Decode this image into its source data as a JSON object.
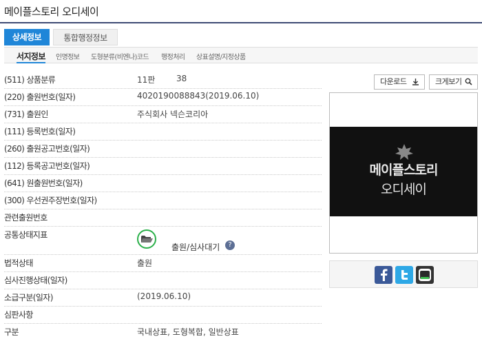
{
  "header": {
    "title": "메이플스토리 오디세이"
  },
  "tabs": [
    {
      "label": "상세정보",
      "active": true
    },
    {
      "label": "통합행정정보",
      "active": false
    }
  ],
  "subnav": [
    "서지정보",
    "인명정보",
    "도형분류(비엔나)코드",
    "행정처리",
    "상표설명/지정상품"
  ],
  "rows": [
    {
      "label": "(511) 상품분류",
      "value": "11판",
      "value2": "38"
    },
    {
      "label": "(220) 출원번호(일자)",
      "value": "4020190088843(2019.06.10)"
    },
    {
      "label": "(731) 출원인",
      "value": "주식회사 넥슨코리아"
    },
    {
      "label": "(111) 등록번호(일자)",
      "value": ""
    },
    {
      "label": "(260) 출원공고번호(일자)",
      "value": ""
    },
    {
      "label": "(112) 등록공고번호(일자)",
      "value": ""
    },
    {
      "label": "(641) 원출원번호(일자)",
      "value": ""
    },
    {
      "label": "(300) 우선권주장번호(일자)",
      "value": ""
    },
    {
      "label": "관련출원번호",
      "value": ""
    },
    {
      "label": "공통상태지표",
      "value": "출원/심사대기"
    },
    {
      "label": "법적상태",
      "value": "출원"
    },
    {
      "label": "심사진행상태(일자)",
      "value": ""
    },
    {
      "label": "소급구분(일자)",
      "value": "(2019.06.10)"
    },
    {
      "label": "심판사항",
      "value": ""
    },
    {
      "label": "구분",
      "value": "국내상표, 도형복합, 일반상표"
    }
  ],
  "buttons": {
    "download": "다운로드",
    "zoom": "크게보기"
  },
  "icons": {
    "download": "download-icon",
    "zoom": "magnifier-icon",
    "status": "folder-open-icon",
    "help": "question-icon",
    "facebook": "facebook-icon",
    "twitter": "twitter-icon",
    "band": "band-icon"
  },
  "mark_image": {
    "line1": "메이플스토리",
    "line2": "오디세이"
  },
  "help_symbol": "?",
  "colors": {
    "accent": "#1f86d8",
    "header_line": "#3d4a73",
    "status_ring": "#2bb04a",
    "facebook": "#3b5998",
    "twitter": "#2ea8e6",
    "band": "#333333"
  }
}
